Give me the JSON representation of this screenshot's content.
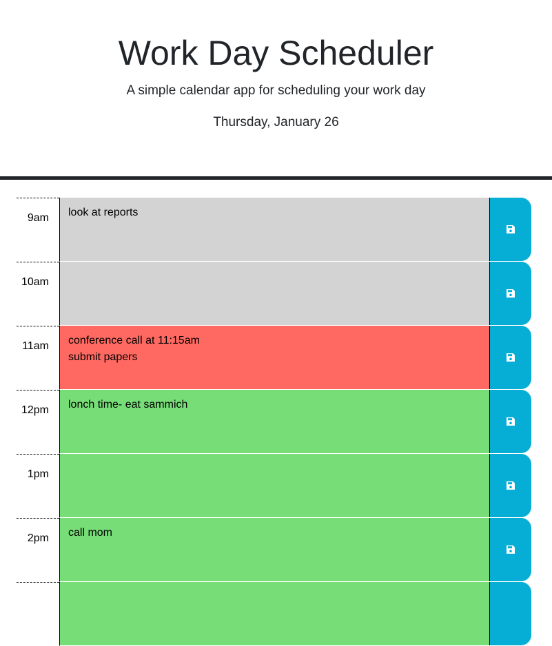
{
  "header": {
    "title": "Work Day Scheduler",
    "subtitle": "A simple calendar app for scheduling your work day",
    "current_day": "Thursday, January 26"
  },
  "colors": {
    "past": "#d3d3d3",
    "present": "#ff6961",
    "future": "#77dd77",
    "save_button": "#06aed5"
  },
  "time_blocks": [
    {
      "hour": "9am",
      "text": "look at reports",
      "state": "past",
      "save_icon": "floppy-disk-icon"
    },
    {
      "hour": "10am",
      "text": "",
      "state": "past",
      "save_icon": "floppy-disk-icon"
    },
    {
      "hour": "11am",
      "text": "conference call at 11:15am\nsubmit papers",
      "state": "present",
      "save_icon": "floppy-disk-icon"
    },
    {
      "hour": "12pm",
      "text": "lonch time- eat sammich",
      "state": "future",
      "save_icon": "floppy-disk-icon"
    },
    {
      "hour": "1pm",
      "text": "",
      "state": "future",
      "save_icon": "floppy-disk-icon"
    },
    {
      "hour": "2pm",
      "text": "call mom",
      "state": "future",
      "save_icon": "floppy-disk-icon"
    }
  ]
}
